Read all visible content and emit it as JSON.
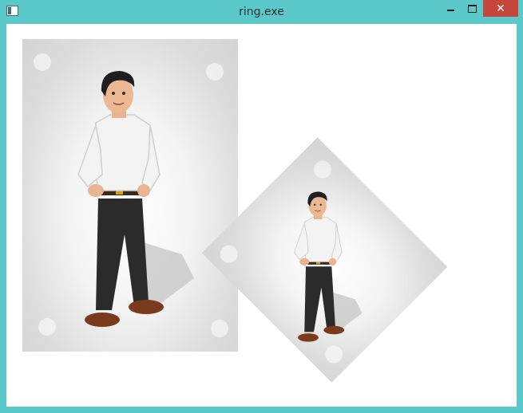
{
  "window": {
    "title": "ring.exe",
    "controls": {
      "minimize": "minimize",
      "maximize": "maximize",
      "close": "close"
    }
  },
  "colors": {
    "frame": "#5bc8ca",
    "close": "#c7463b",
    "client_bg": "#ffffff"
  },
  "images": [
    {
      "name": "original-image",
      "rotation_deg": 0
    },
    {
      "name": "rotated-image",
      "rotation_deg": -45
    }
  ]
}
